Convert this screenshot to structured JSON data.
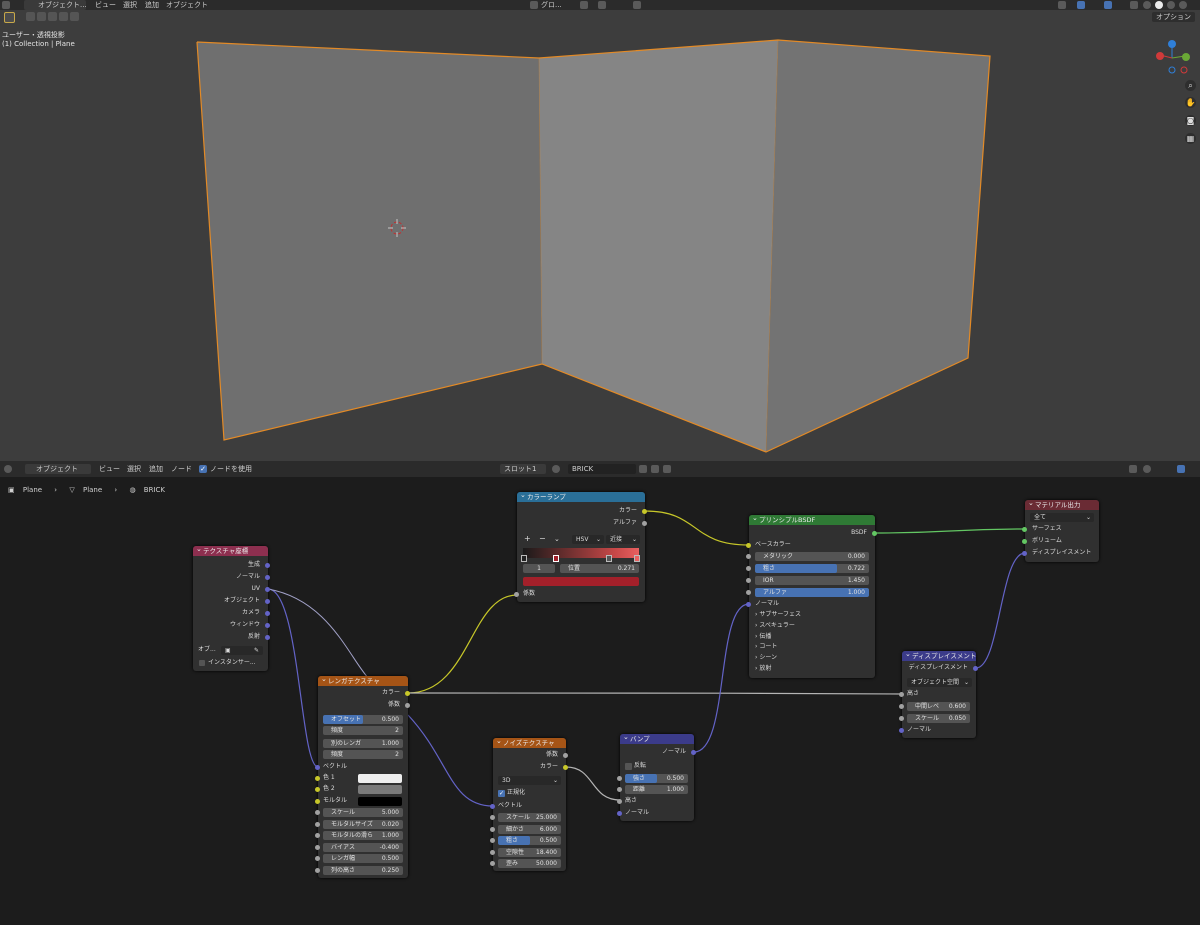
{
  "topbar": {
    "mode": "オブジェクト...",
    "menus": [
      "ビュー",
      "選択",
      "追加",
      "オブジェクト"
    ],
    "transform": "グロ...",
    "options": "オプション"
  },
  "viewport": {
    "view_name": "ユーザー・透視投影",
    "collection": "(1) Collection | Plane",
    "object_outline_color": "#e38a26",
    "nav_icons": [
      "zoom-icon",
      "hand-icon",
      "camera-icon",
      "grid-icon"
    ]
  },
  "node_header": {
    "mode": "オブジェクト",
    "menus": [
      "ビュー",
      "選択",
      "追加",
      "ノード"
    ],
    "use_nodes_label": "ノードを使用",
    "use_nodes": true,
    "slot": "スロット1",
    "material": "BRICK"
  },
  "breadcrumb": [
    "Plane",
    "Plane",
    "BRICK"
  ],
  "nodes": {
    "texcoord": {
      "title": "テクスチャ座標",
      "outputs": [
        "生成",
        "ノーマル",
        "UV",
        "オブジェクト",
        "カメラ",
        "ウィンドウ",
        "反射"
      ],
      "object_label": "オブ...",
      "instancer": "インスタンサー..."
    },
    "colorramp": {
      "title": "カラーランプ",
      "outputs": [
        "カラー",
        "アルファ"
      ],
      "mode": "HSV",
      "interp": "近接",
      "index": "1",
      "pos_label": "位置",
      "pos_value": "0.271",
      "input": "係数",
      "selected_color": "#a3202a"
    },
    "principled": {
      "title": "プリンシプルBSDF",
      "output": "BSDF",
      "base_color": "ベースカラー",
      "fields": [
        {
          "label": "メタリック",
          "value": "0.000",
          "fill": 0.0
        },
        {
          "label": "粗さ",
          "value": "0.722",
          "fill": 0.722
        },
        {
          "label": "IOR",
          "value": "1.450",
          "fill": 0.0
        },
        {
          "label": "アルファ",
          "value": "1.000",
          "fill": 1.0
        }
      ],
      "normal": "ノーマル",
      "panels": [
        "サブサーフェス",
        "スペキュラー",
        "伝播",
        "コート",
        "シーン",
        "放射"
      ]
    },
    "output": {
      "title": "マテリアル出力",
      "target": "全て",
      "inputs": [
        "サーフェス",
        "ボリューム",
        "ディスプレイスメント"
      ]
    },
    "brick": {
      "title": "レンガテクスチャ",
      "outputs": [
        "カラー",
        "係数"
      ],
      "fields": [
        {
          "label": "オフセット",
          "value": "0.500",
          "fill": 0.5
        },
        {
          "label": "頻度",
          "value": "2",
          "fill": 0
        },
        {
          "label": "別のレンガ",
          "value": "1.000",
          "fill": 0
        },
        {
          "label": "頻度",
          "value": "2",
          "fill": 0
        }
      ],
      "vector": "ベクトル",
      "colors": [
        {
          "label": "色 1",
          "swatch": "#efefef"
        },
        {
          "label": "色 2",
          "swatch": "#7a7a7a"
        },
        {
          "label": "モルタル",
          "swatch": "#000000"
        }
      ],
      "params": [
        {
          "label": "スケール",
          "value": "5.000"
        },
        {
          "label": "モルタルサイズ",
          "value": "0.020"
        },
        {
          "label": "モルタルの滑ら",
          "value": "1.000"
        },
        {
          "label": "バイアス",
          "value": "-0.400"
        },
        {
          "label": "レンガ幅",
          "value": "0.500"
        },
        {
          "label": "列の高さ",
          "value": "0.250"
        }
      ]
    },
    "noise": {
      "title": "ノイズテクスチャ",
      "outputs": [
        "係数",
        "カラー"
      ],
      "dim": "3D",
      "normalize_label": "正規化",
      "vector": "ベクトル",
      "params": [
        {
          "label": "スケール",
          "value": "25.000",
          "fill": 0
        },
        {
          "label": "細かさ",
          "value": "6.000",
          "fill": 0
        },
        {
          "label": "粗さ",
          "value": "0.500",
          "fill": 0.5
        },
        {
          "label": "空隙性",
          "value": "18.400",
          "fill": 0
        },
        {
          "label": "歪み",
          "value": "50.000",
          "fill": 0
        }
      ]
    },
    "bump": {
      "title": "バンプ",
      "output": "ノーマル",
      "invert_label": "反転",
      "params": [
        {
          "label": "強さ",
          "value": "0.500",
          "fill": 0.5
        },
        {
          "label": "距離",
          "value": "1.000",
          "fill": 0
        }
      ],
      "inputs": [
        "高さ",
        "ノーマル"
      ]
    },
    "displacement": {
      "title": "ディスプレイスメント",
      "output": "ディスプレイスメント",
      "space": "オブジェクト空間",
      "height": "高さ",
      "params": [
        {
          "label": "中間レベ",
          "value": "0.600"
        },
        {
          "label": "スケール",
          "value": "0.050"
        }
      ],
      "normal": "ノーマル"
    }
  }
}
